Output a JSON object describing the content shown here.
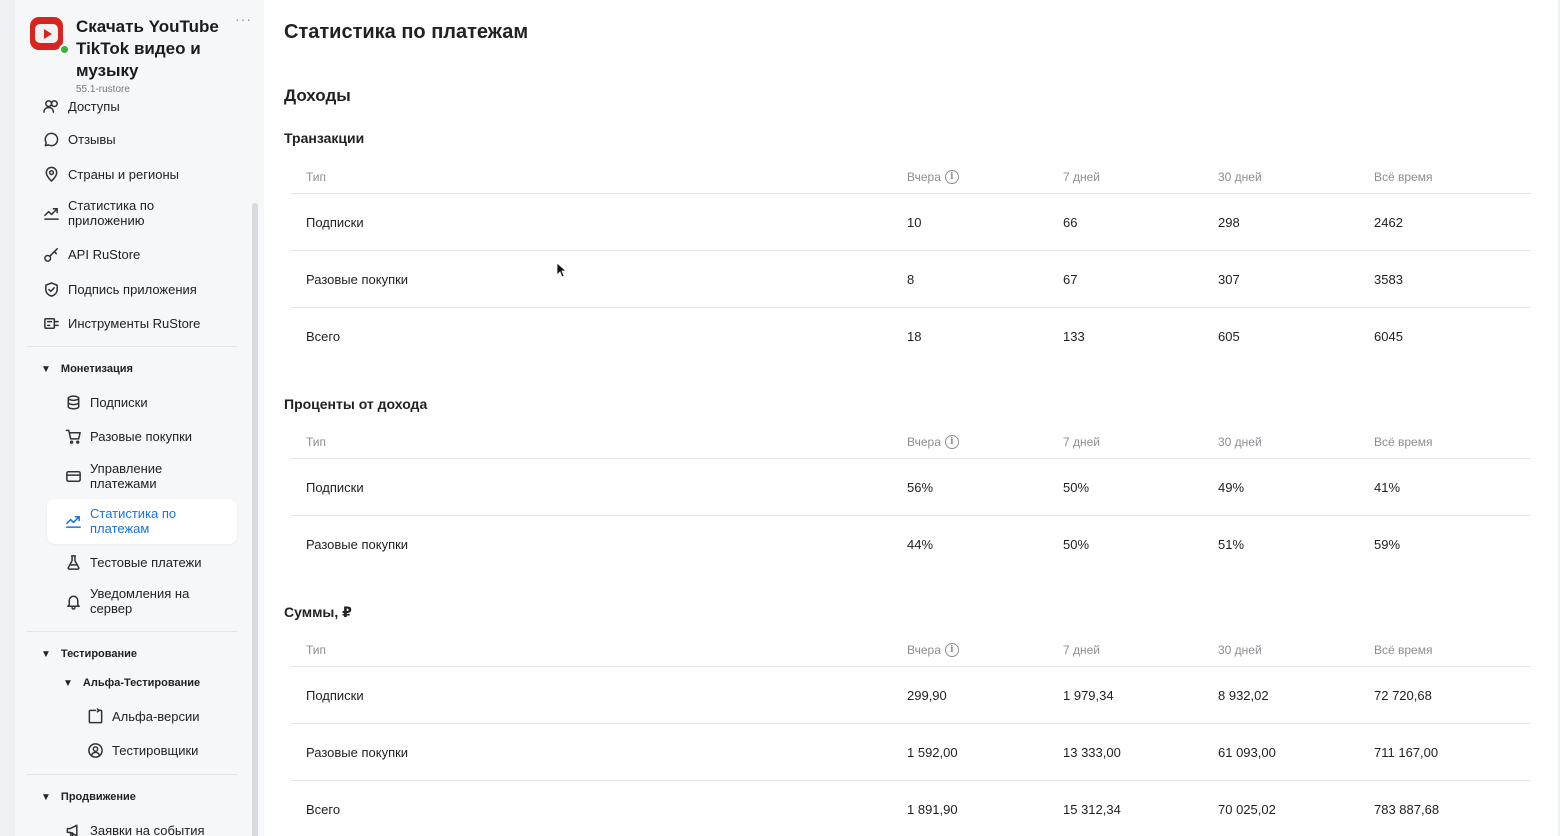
{
  "app": {
    "title": "Скачать YouTube TikTok видео и музыку",
    "version": "55.1-rustore",
    "more": "···"
  },
  "sidebar": {
    "partial_item": "Доступы",
    "items": [
      {
        "label": "Отзывы",
        "icon": "chat-bubble-icon"
      },
      {
        "label": "Страны и регионы",
        "icon": "location-pin-icon"
      },
      {
        "label": "Статистика по приложению",
        "icon": "trend-chart-icon"
      },
      {
        "label": "API RuStore",
        "icon": "key-icon"
      },
      {
        "label": "Подпись приложения",
        "icon": "shield-check-icon"
      },
      {
        "label": "Инструменты RuStore",
        "icon": "tools-icon"
      }
    ],
    "monetization": {
      "title": "Монетизация",
      "items": [
        {
          "label": "Подписки",
          "icon": "database-icon"
        },
        {
          "label": "Разовые покупки",
          "icon": "cart-icon"
        },
        {
          "label": "Управление платежами",
          "icon": "card-icon"
        },
        {
          "label": "Статистика по платежам",
          "icon": "trend-chart-icon",
          "active": true
        },
        {
          "label": "Тестовые платежи",
          "icon": "flask-icon"
        },
        {
          "label": "Уведомления на сервер",
          "icon": "bell-icon"
        }
      ]
    },
    "testing": {
      "title": "Тестирование",
      "alpha": {
        "title": "Альфа-Тестирование",
        "items": [
          {
            "label": "Альфа-версии",
            "icon": "square-refresh-icon"
          },
          {
            "label": "Тестировщики",
            "icon": "user-circle-icon"
          }
        ]
      }
    },
    "promotion": {
      "title": "Продвижение",
      "items": [
        {
          "label": "Заявки на события",
          "icon": "megaphone-icon"
        }
      ]
    }
  },
  "main": {
    "page_title": "Статистика по платежам",
    "income_title": "Доходы",
    "columns": [
      "Тип",
      "Вчера",
      "7 дней",
      "30 дней",
      "Всё время"
    ],
    "transactions": {
      "title": "Транзакции",
      "rows": [
        [
          "Подписки",
          "10",
          "66",
          "298",
          "2462"
        ],
        [
          "Разовые покупки",
          "8",
          "67",
          "307",
          "3583"
        ],
        [
          "Всего",
          "18",
          "133",
          "605",
          "6045"
        ]
      ]
    },
    "percent": {
      "title": "Проценты от дохода",
      "rows": [
        [
          "Подписки",
          "56%",
          "50%",
          "49%",
          "41%"
        ],
        [
          "Разовые покупки",
          "44%",
          "50%",
          "51%",
          "59%"
        ]
      ]
    },
    "sums": {
      "title": "Суммы, ₽",
      "rows": [
        [
          "Подписки",
          "299,90",
          "1 979,34",
          "8 932,02",
          "72 720,68"
        ],
        [
          "Разовые покупки",
          "1 592,00",
          "13 333,00",
          "61 093,00",
          "711 167,00"
        ],
        [
          "Всего",
          "1 891,90",
          "15 312,34",
          "70 025,02",
          "783 887,68"
        ]
      ]
    }
  }
}
